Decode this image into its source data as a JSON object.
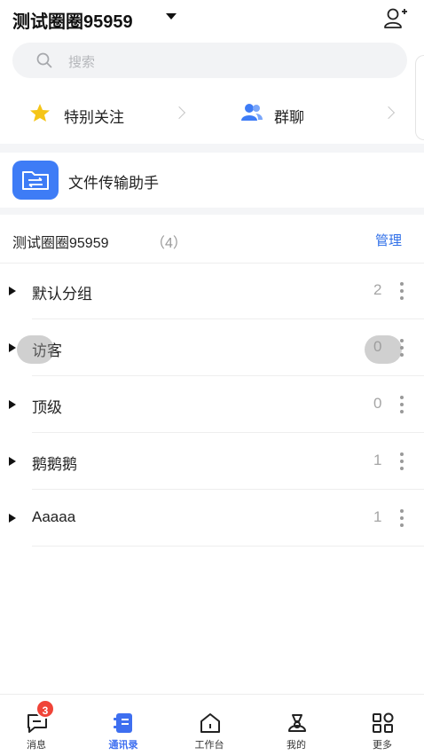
{
  "header": {
    "title": "测试圈圈95959"
  },
  "search": {
    "placeholder": "搜索"
  },
  "quick_links": [
    {
      "label": "特别关注"
    },
    {
      "label": "群聊"
    }
  ],
  "file_helper": {
    "label": "文件传输助手"
  },
  "group_section": {
    "title": "测试圈圈95959",
    "count": "（4）",
    "manage_label": "管理"
  },
  "groups": [
    {
      "name": "默认分组",
      "count": "2"
    },
    {
      "name": "访客",
      "count": "0"
    },
    {
      "name": "顶级",
      "count": "0"
    },
    {
      "name": "鹅鹅鹅",
      "count": "1"
    },
    {
      "name": "Aaaaa",
      "count": "1"
    }
  ],
  "tabs": [
    {
      "label": "消息",
      "icon": "message-icon",
      "badge": "3"
    },
    {
      "label": "通讯录",
      "icon": "contacts-icon",
      "active": true
    },
    {
      "label": "工作台",
      "icon": "workbench-icon"
    },
    {
      "label": "我的",
      "icon": "profile-icon"
    },
    {
      "label": "更多",
      "icon": "more-apps-icon"
    }
  ],
  "colors": {
    "accent": "#2f6fe8",
    "badge": "#f04438",
    "file_icon_bg": "#3e7cf6",
    "star": "#f5c518"
  }
}
